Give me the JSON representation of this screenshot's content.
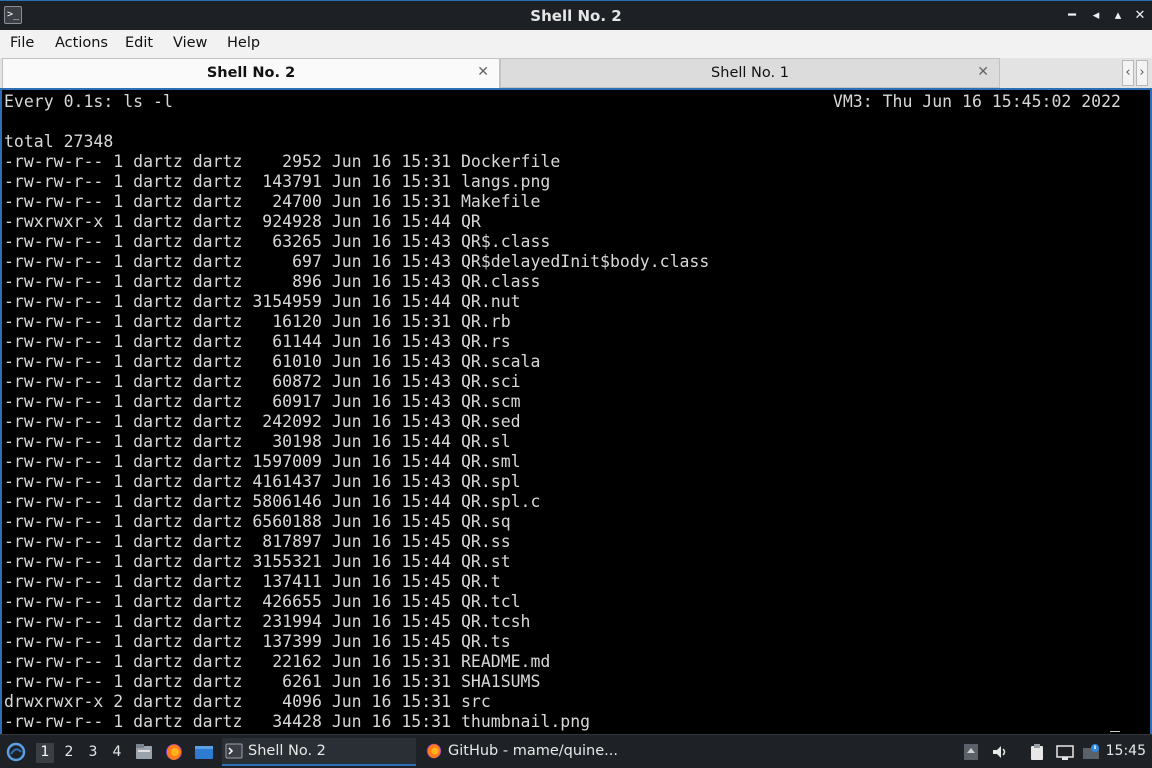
{
  "window": {
    "title": "Shell No. 2",
    "icon": "terminal-icon",
    "controls": [
      "minimize-icon",
      "restore-icon",
      "maximize-icon",
      "close-icon"
    ]
  },
  "menu": {
    "file": "File",
    "actions": "Actions",
    "edit": "Edit",
    "view": "View",
    "help": "Help"
  },
  "tabs": [
    {
      "label": "Shell No. 2",
      "active": true
    },
    {
      "label": "Shell No. 1",
      "active": false
    }
  ],
  "terminal": {
    "watch_command": "Every 0.1s: ls -l",
    "watch_status": "VM3: Thu Jun 16 15:45:02 2022",
    "lines": [
      "total 27348",
      "-rw-rw-r-- 1 dartz dartz    2952 Jun 16 15:31 Dockerfile",
      "-rw-rw-r-- 1 dartz dartz  143791 Jun 16 15:31 langs.png",
      "-rw-rw-r-- 1 dartz dartz   24700 Jun 16 15:31 Makefile",
      "-rwxrwxr-x 1 dartz dartz  924928 Jun 16 15:44 QR",
      "-rw-rw-r-- 1 dartz dartz   63265 Jun 16 15:43 QR$.class",
      "-rw-rw-r-- 1 dartz dartz     697 Jun 16 15:43 QR$delayedInit$body.class",
      "-rw-rw-r-- 1 dartz dartz     896 Jun 16 15:43 QR.class",
      "-rw-rw-r-- 1 dartz dartz 3154959 Jun 16 15:44 QR.nut",
      "-rw-rw-r-- 1 dartz dartz   16120 Jun 16 15:31 QR.rb",
      "-rw-rw-r-- 1 dartz dartz   61144 Jun 16 15:43 QR.rs",
      "-rw-rw-r-- 1 dartz dartz   61010 Jun 16 15:43 QR.scala",
      "-rw-rw-r-- 1 dartz dartz   60872 Jun 16 15:43 QR.sci",
      "-rw-rw-r-- 1 dartz dartz   60917 Jun 16 15:43 QR.scm",
      "-rw-rw-r-- 1 dartz dartz  242092 Jun 16 15:43 QR.sed",
      "-rw-rw-r-- 1 dartz dartz   30198 Jun 16 15:44 QR.sl",
      "-rw-rw-r-- 1 dartz dartz 1597009 Jun 16 15:44 QR.sml",
      "-rw-rw-r-- 1 dartz dartz 4161437 Jun 16 15:43 QR.spl",
      "-rw-rw-r-- 1 dartz dartz 5806146 Jun 16 15:44 QR.spl.c",
      "-rw-rw-r-- 1 dartz dartz 6560188 Jun 16 15:45 QR.sq",
      "-rw-rw-r-- 1 dartz dartz  817897 Jun 16 15:45 QR.ss",
      "-rw-rw-r-- 1 dartz dartz 3155321 Jun 16 15:44 QR.st",
      "-rw-rw-r-- 1 dartz dartz  137411 Jun 16 15:45 QR.t",
      "-rw-rw-r-- 1 dartz dartz  426655 Jun 16 15:45 QR.tcl",
      "-rw-rw-r-- 1 dartz dartz  231994 Jun 16 15:45 QR.tcsh",
      "-rw-rw-r-- 1 dartz dartz  137399 Jun 16 15:45 QR.ts",
      "-rw-rw-r-- 1 dartz dartz   22162 Jun 16 15:31 README.md",
      "-rw-rw-r-- 1 dartz dartz    6261 Jun 16 15:31 SHA1SUMS",
      "drwxrwxr-x 2 dartz dartz    4096 Jun 16 15:31 src",
      "-rw-rw-r-- 1 dartz dartz   34428 Jun 16 15:31 thumbnail.png"
    ]
  },
  "taskbar": {
    "start_icon": "lxqt-start-icon",
    "workspaces": [
      "1",
      "2",
      "3",
      "4"
    ],
    "launchers": [
      "file-manager-icon",
      "firefox-icon",
      "show-desktop-icon"
    ],
    "tasks": [
      {
        "label": "Shell No. 2",
        "icon": "terminal-icon",
        "active": true
      },
      {
        "label": "GitHub - mame/quine...",
        "icon": "firefox-icon",
        "active": false
      }
    ],
    "tray": [
      "tray-up-arrow-icon",
      "volume-icon",
      "clipboard-icon",
      "network-icon",
      "updates-icon"
    ],
    "clock": "15:45"
  },
  "colors": {
    "accent": "#2d6fb5",
    "terminal_bg": "#000000",
    "terminal_fg": "#d8d8d8",
    "titlebar_bg": "#1d2125",
    "taskbar_bg": "#1e2226"
  }
}
